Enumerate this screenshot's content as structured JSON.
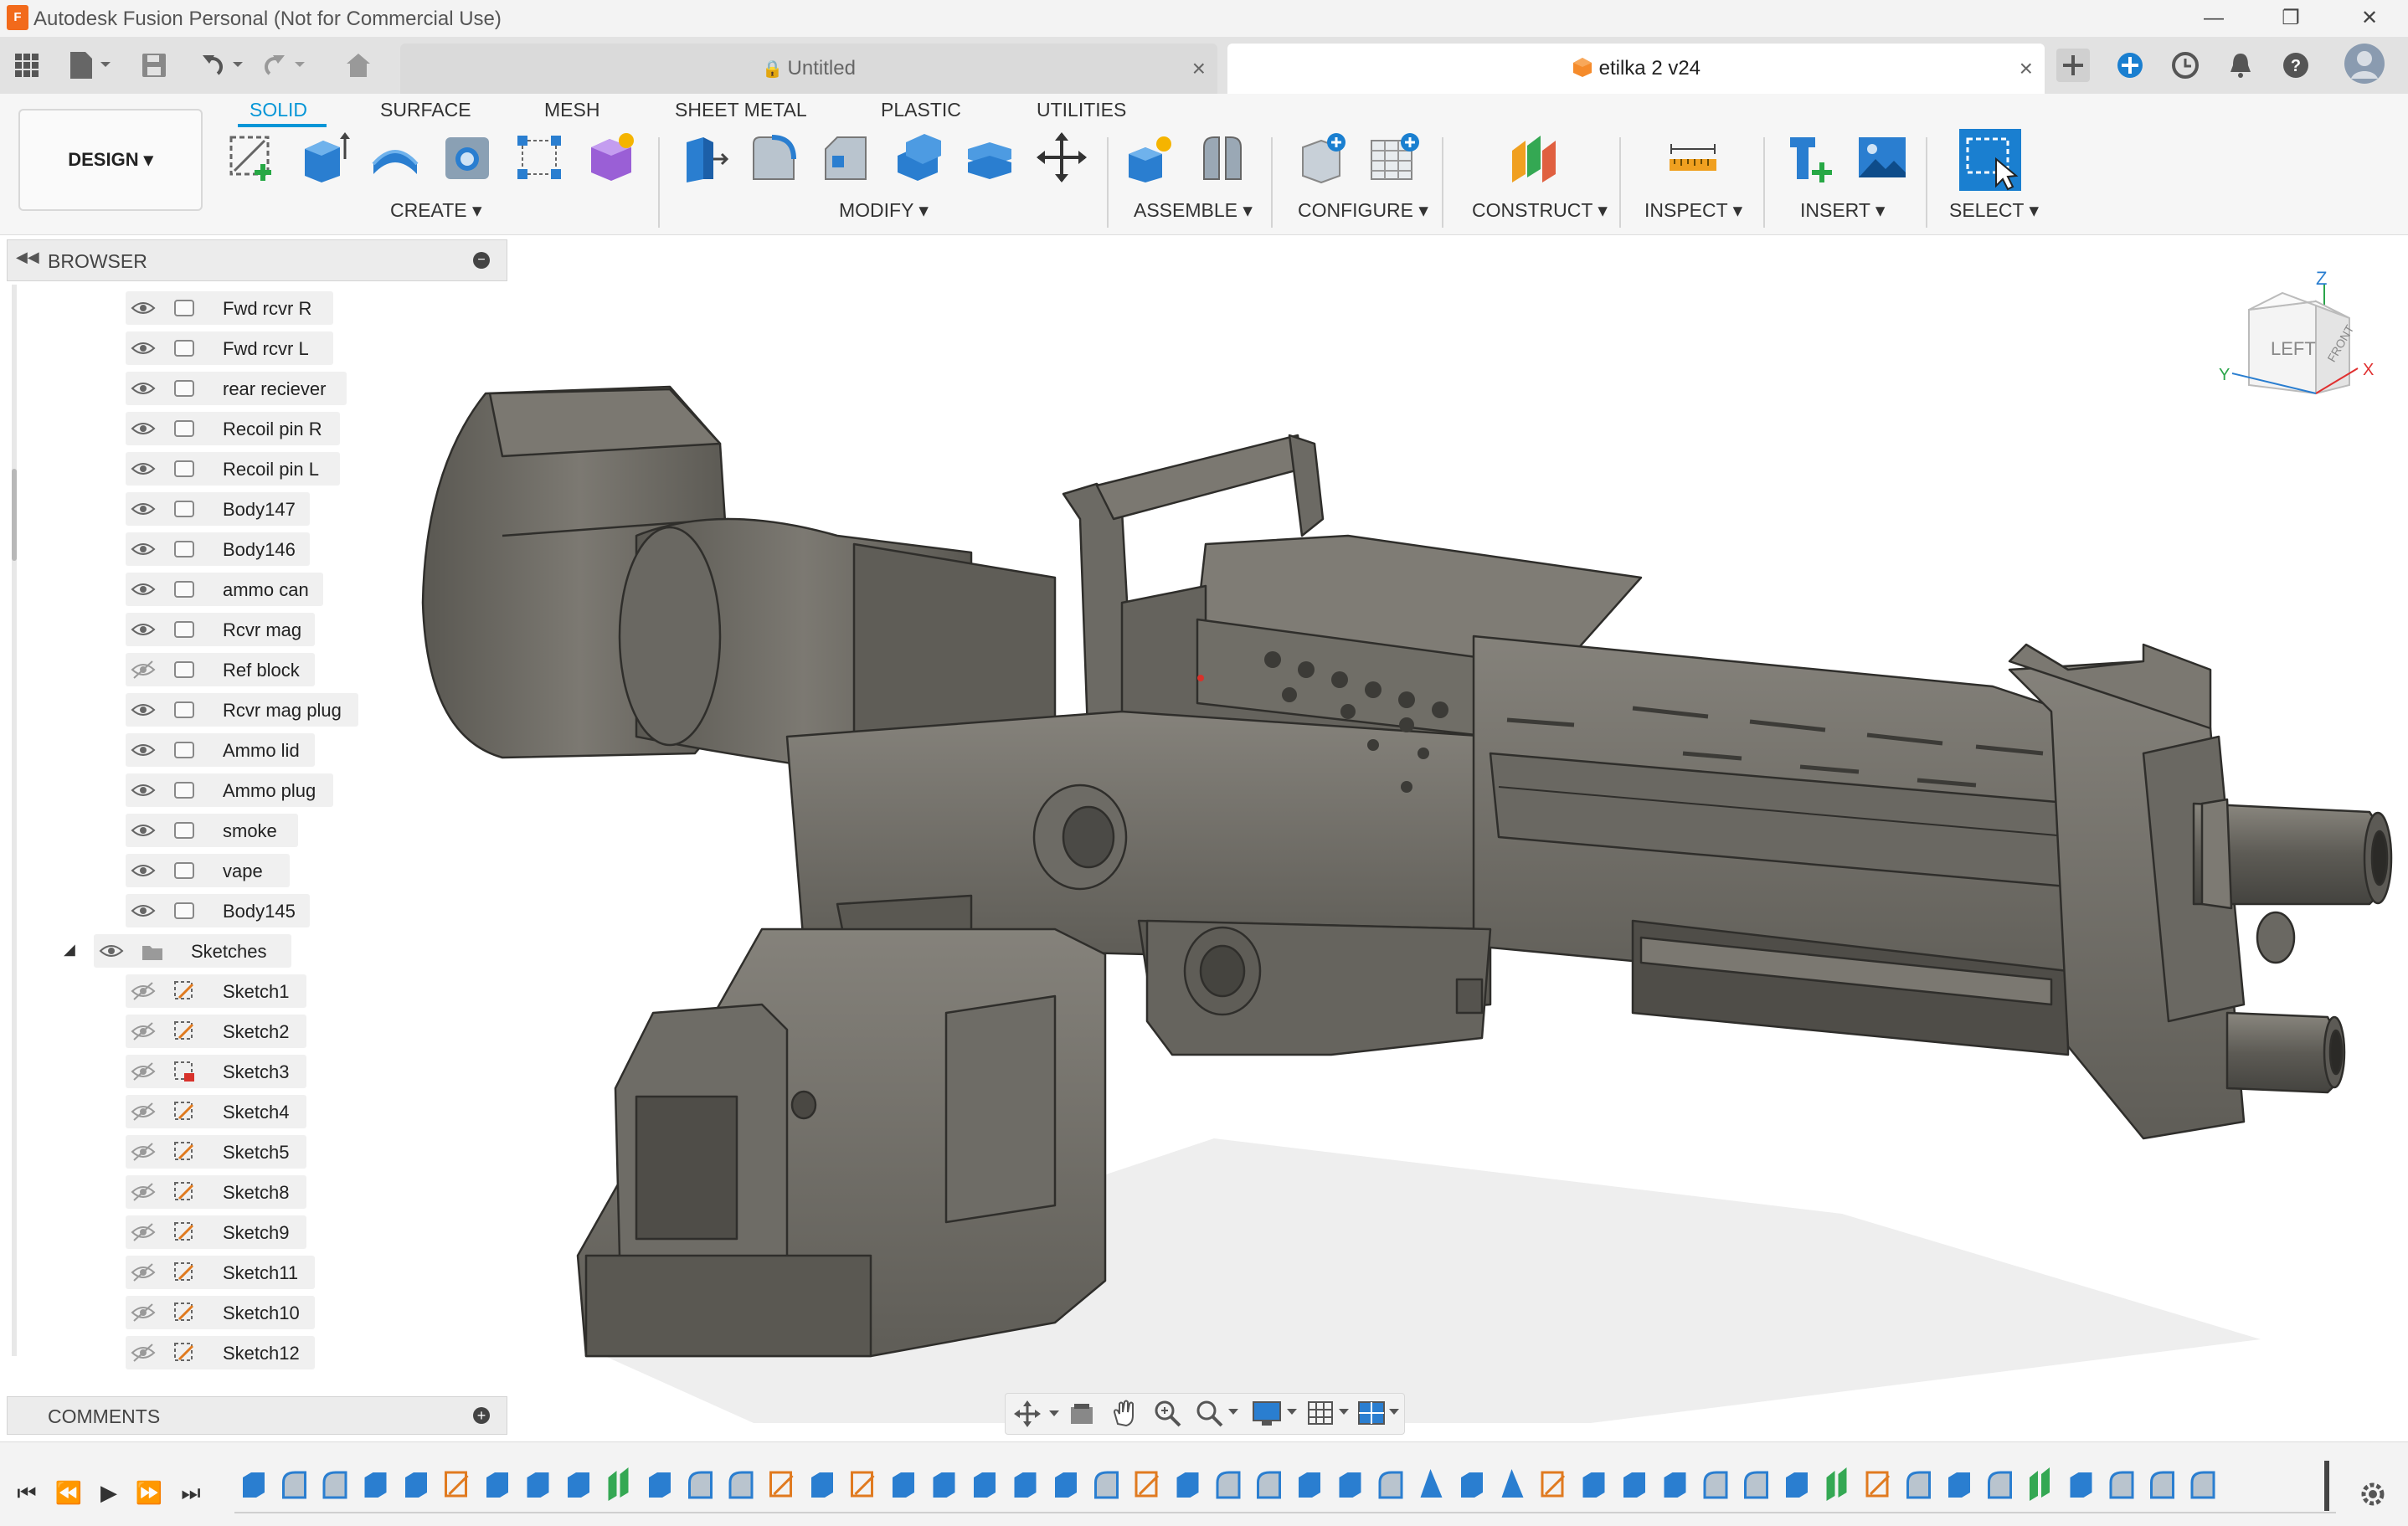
{
  "window": {
    "title": "Autodesk Fusion Personal (Not for Commercial Use)",
    "logo_text": "F"
  },
  "tabs": [
    {
      "label": "Untitled",
      "locked": true,
      "active": false
    },
    {
      "label": "etilka 2 v24",
      "active": true
    }
  ],
  "ribbon": {
    "workspace": "DESIGN",
    "tabs": [
      "SOLID",
      "SURFACE",
      "MESH",
      "SHEET METAL",
      "PLASTIC",
      "UTILITIES"
    ],
    "active_tab": "SOLID",
    "groups": [
      "CREATE",
      "MODIFY",
      "ASSEMBLE",
      "CONFIGURE",
      "CONSTRUCT",
      "INSPECT",
      "INSERT",
      "SELECT"
    ]
  },
  "browser": {
    "title": "BROWSER",
    "bodies": [
      {
        "label": "Fwd rcvr R",
        "visible": true
      },
      {
        "label": "Fwd rcvr L",
        "visible": true
      },
      {
        "label": "rear reciever",
        "visible": true
      },
      {
        "label": "Recoil pin R",
        "visible": true
      },
      {
        "label": "Recoil pin L",
        "visible": true
      },
      {
        "label": "Body147",
        "visible": true
      },
      {
        "label": "Body146",
        "visible": true
      },
      {
        "label": "ammo can",
        "visible": true
      },
      {
        "label": "Rcvr mag",
        "visible": true
      },
      {
        "label": "Ref block",
        "visible": false
      },
      {
        "label": "Rcvr mag plug",
        "visible": true
      },
      {
        "label": "Ammo lid",
        "visible": true
      },
      {
        "label": "Ammo plug",
        "visible": true
      },
      {
        "label": "smoke",
        "visible": true
      },
      {
        "label": "vape",
        "visible": true
      },
      {
        "label": "Body145",
        "visible": true
      }
    ],
    "sketches_folder": "Sketches",
    "sketches": [
      "Sketch1",
      "Sketch2",
      "Sketch3",
      "Sketch4",
      "Sketch5",
      "Sketch8",
      "Sketch9",
      "Sketch11",
      "Sketch10",
      "Sketch12"
    ]
  },
  "comments": {
    "title": "COMMENTS"
  },
  "viewcube": {
    "faces": [
      "LEFT",
      "FRONT"
    ],
    "axes": [
      "Z",
      "Y",
      "X"
    ]
  },
  "colors": {
    "accent": "#0696d7",
    "model_body": "#6e6b64",
    "model_shade": "#4a4843",
    "model_highlight": "#8c8982",
    "fusion_orange": "#f26a1b"
  }
}
